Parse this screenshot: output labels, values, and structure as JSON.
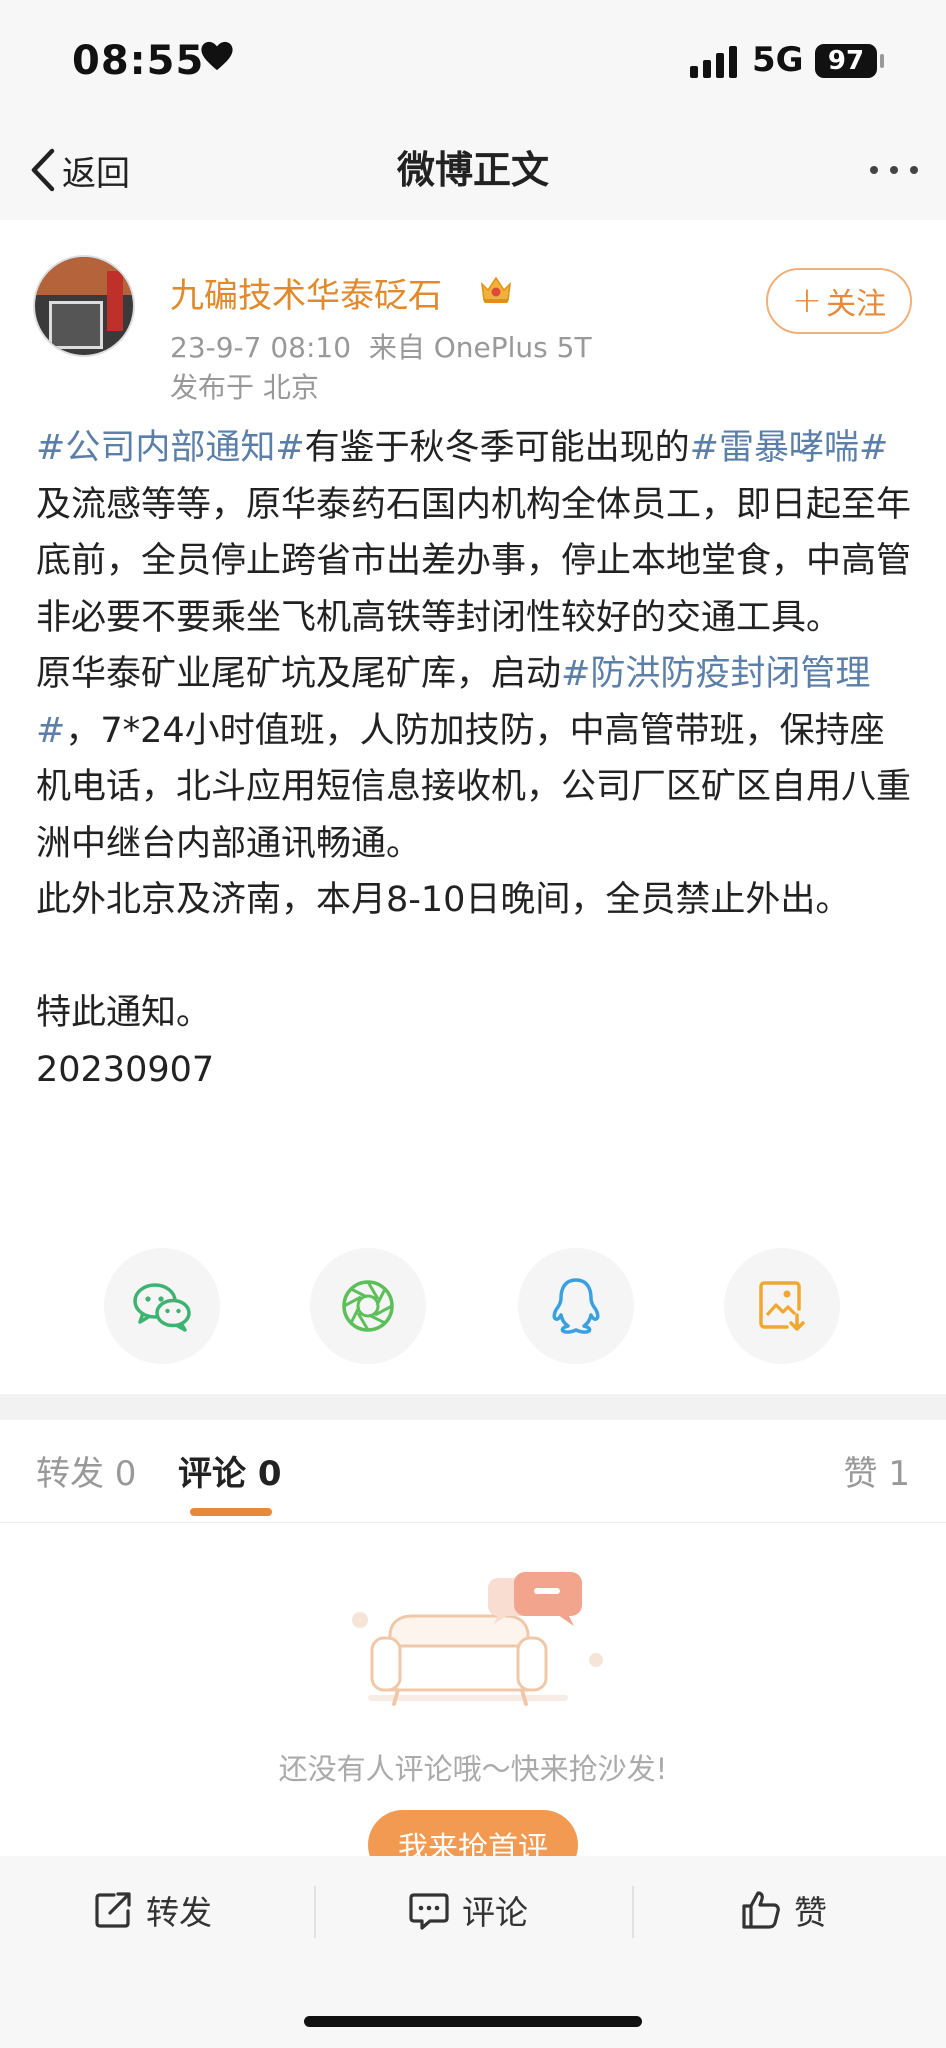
{
  "status_bar": {
    "time": "08:55",
    "network": "5G",
    "battery": "97"
  },
  "nav": {
    "back_label": "返回",
    "title": "微博正文"
  },
  "post": {
    "username": "九碥技术华泰砭石",
    "meta": "23-9-7 08:10  来自 OnePlus 5T",
    "location": "发布于 北京",
    "follow_label": "关注",
    "paragraphs": {
      "p1": {
        "tag1": "#公司内部通知#",
        "t1": "有鉴于秋冬季可能出现的",
        "tag2": "#雷暴哮喘#",
        "t2": " 及流感等等，原华泰药石国内机构全体员工，即日起至年底前，全员停止跨省市出差办事，停止本地堂食，中高管非必要不要乘坐飞机高铁等封闭性较好的交通工具。"
      },
      "p2": {
        "t1": "原华泰矿业尾矿坑及尾矿库，启动",
        "tag1": "#防洪防疫封闭管理#",
        "t2": "，7*24小时值班，人防加技防，中高管带班，保持座机电话，北斗应用短信息接收机，公司厂区矿区自用八重洲中继台内部通讯畅通。"
      },
      "p3": "此外北京及济南，本月8-10日晚间，全员禁止外出。",
      "p4": "特此通知。",
      "p5": "20230907"
    }
  },
  "share": {
    "icons": [
      "wechat-icon",
      "moments-icon",
      "qq-icon",
      "save-image-icon"
    ],
    "colors": {
      "wechat": "#3cb371",
      "moments": "#5cbf5a",
      "qq": "#3aa0e0",
      "save": "#f0a830"
    }
  },
  "tabs": {
    "repost": "转发 0",
    "comment": "评论 0",
    "like": "赞 1"
  },
  "empty_state": {
    "text": "还没有人评论哦～快来抢沙发!",
    "button": "我来抢首评"
  },
  "bottom_bar": {
    "repost": "转发",
    "comment": "评论",
    "like": "赞"
  },
  "colors": {
    "accent": "#e8893a",
    "tag": "#5b7fa8",
    "username": "#e08a2c"
  }
}
